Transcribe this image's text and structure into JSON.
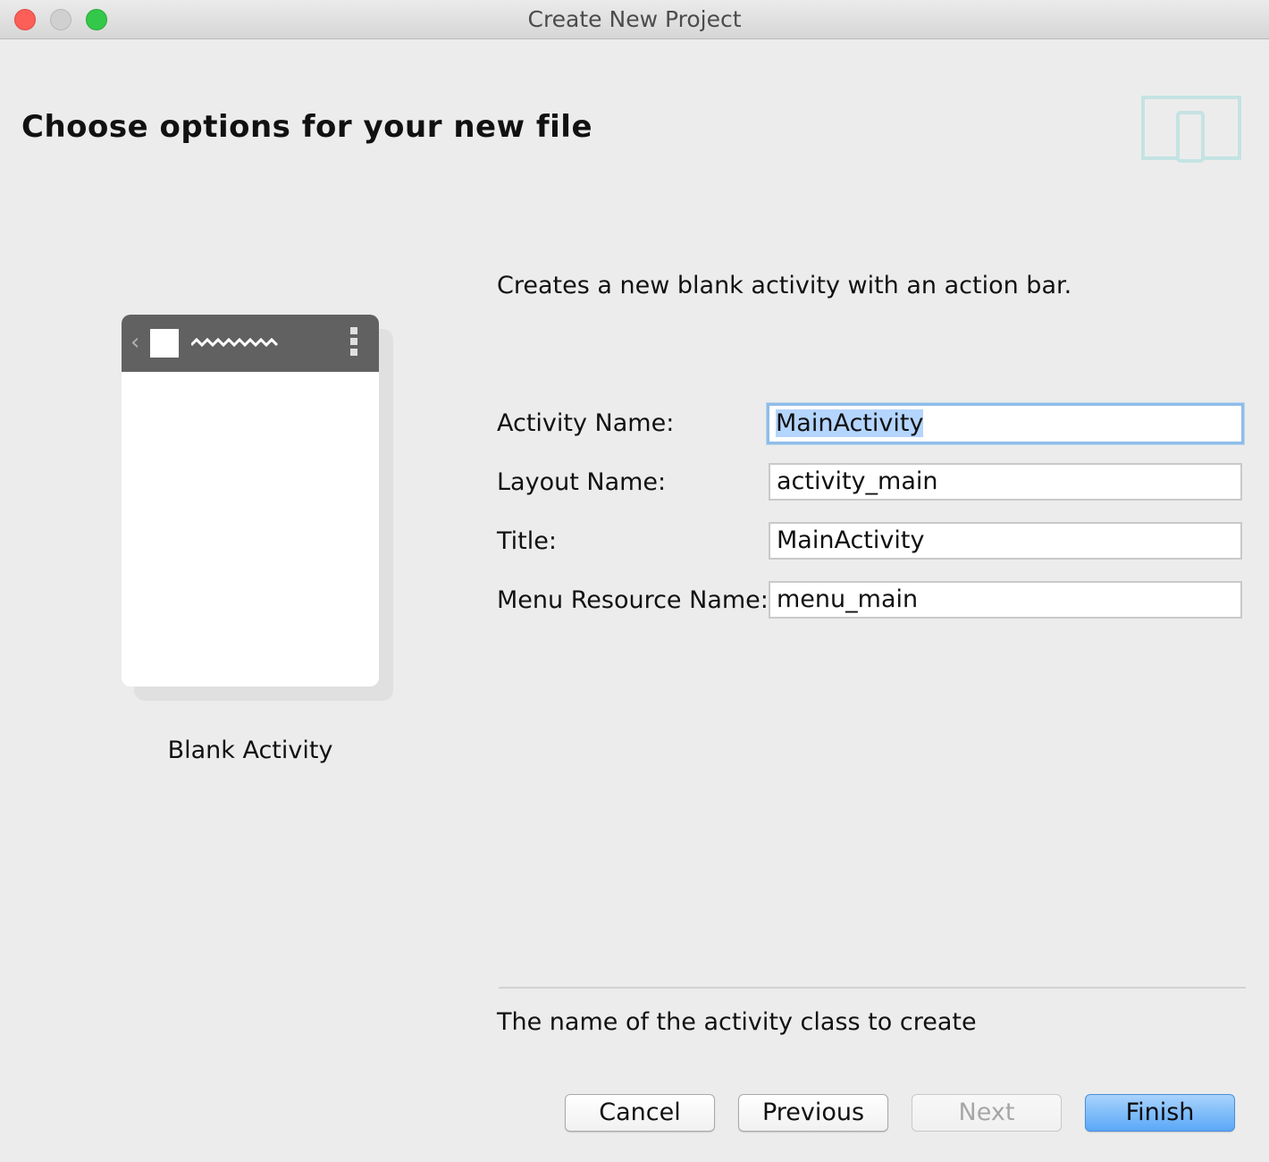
{
  "window": {
    "title": "Create New Project"
  },
  "header": {
    "heading": "Choose options for your new file",
    "device_icon": "tablet-phone-icon"
  },
  "preview": {
    "label": "Blank Activity"
  },
  "description": "Creates a new blank activity with an action bar.",
  "form": {
    "activity_name_label": "Activity Name:",
    "activity_name_value": "MainActivity",
    "layout_name_label": "Layout Name:",
    "layout_name_value": "activity_main",
    "title_label": "Title:",
    "title_value": "MainActivity",
    "menu_resource_label": "Menu Resource Name:",
    "menu_resource_value": "menu_main"
  },
  "help_text": "The name of the activity class to create",
  "buttons": {
    "cancel": "Cancel",
    "previous": "Previous",
    "next": "Next",
    "finish": "Finish"
  },
  "colors": {
    "close": "#fc5f57",
    "minimize": "#d0d0d0",
    "maximize": "#34c84a",
    "primary_button": "#5aa8f7",
    "focus_ring": "#8fbde8",
    "icon_tint": "#c5e3e3"
  }
}
